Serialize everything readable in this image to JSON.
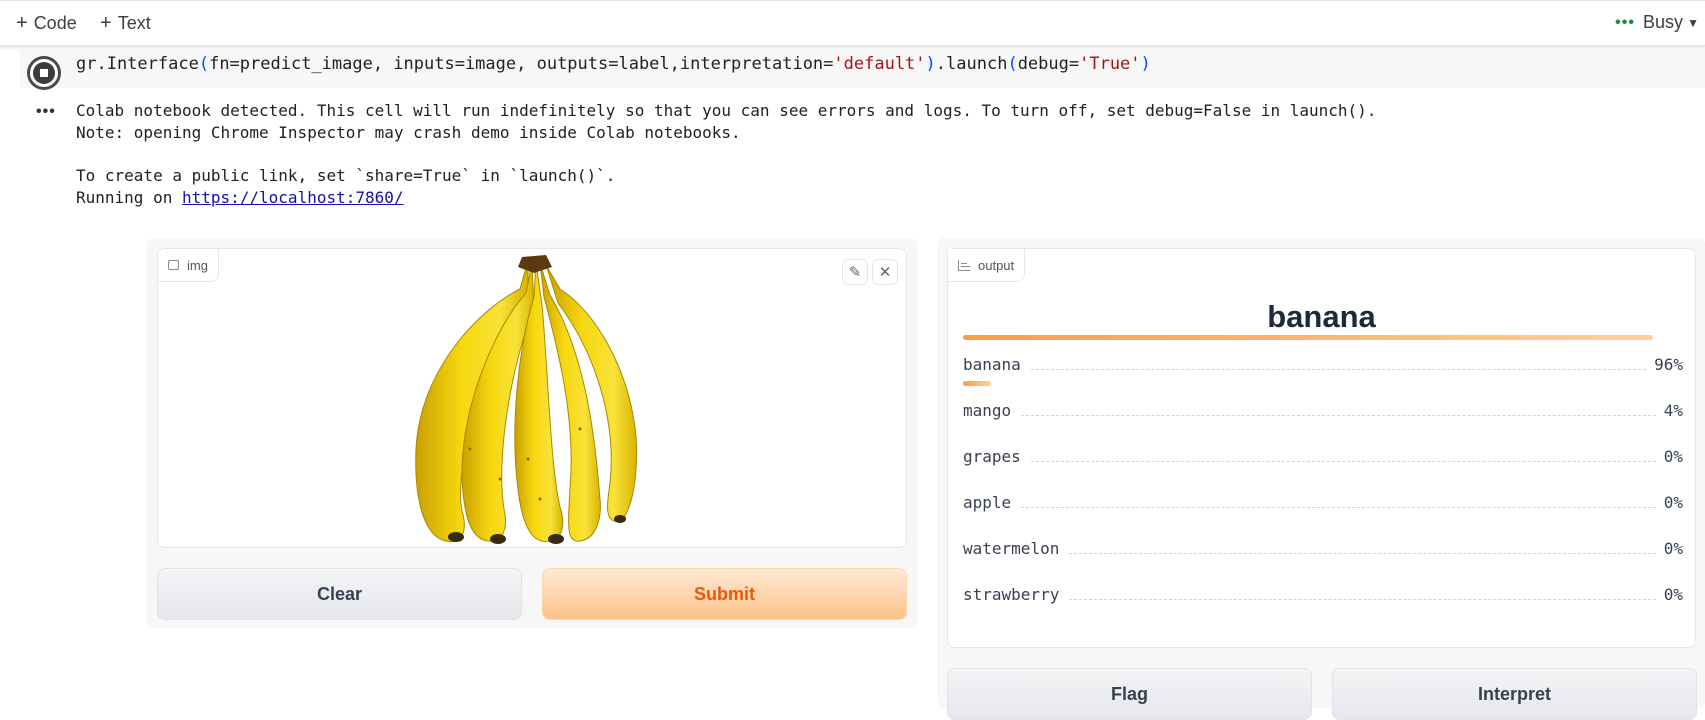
{
  "toolbar": {
    "code_label": "Code",
    "text_label": "Text",
    "status_label": "Busy"
  },
  "cell": {
    "code_prefix": "gr.Interface",
    "code_open": "(",
    "code_mid": "fn=predict_image, inputs=image, outputs=label,interpretation=",
    "code_str1": "'default'",
    "code_close": ")",
    "code_launch": ".launch",
    "code_open2": "(",
    "code_debug": "debug=",
    "code_str2": "'True'",
    "code_close2": ")"
  },
  "output": {
    "line1": "Colab notebook detected. This cell will run indefinitely so that you can see errors and logs. To turn off, set debug=False in launch().",
    "line2": "Note: opening Chrome Inspector may crash demo inside Colab notebooks.",
    "line3": "To create a public link, set `share=True` in `launch()`.",
    "line4_prefix": "Running on ",
    "link": "https://localhost:7860/"
  },
  "gradio": {
    "input_label": "img",
    "output_label": "output",
    "clear_label": "Clear",
    "submit_label": "Submit",
    "flag_label": "Flag",
    "interpret_label": "Interpret",
    "predicted_label": "banana",
    "colors": {
      "primary": "#ea580c",
      "bar": "#f59e4a"
    },
    "confidences": [
      {
        "name": "banana",
        "pct": "96%",
        "value": 0.96
      },
      {
        "name": "mango",
        "pct": "4%",
        "value": 0.04
      },
      {
        "name": "grapes",
        "pct": "0%",
        "value": 0
      },
      {
        "name": "apple",
        "pct": "0%",
        "value": 0
      },
      {
        "name": "watermelon",
        "pct": "0%",
        "value": 0
      },
      {
        "name": "strawberry",
        "pct": "0%",
        "value": 0
      }
    ]
  }
}
